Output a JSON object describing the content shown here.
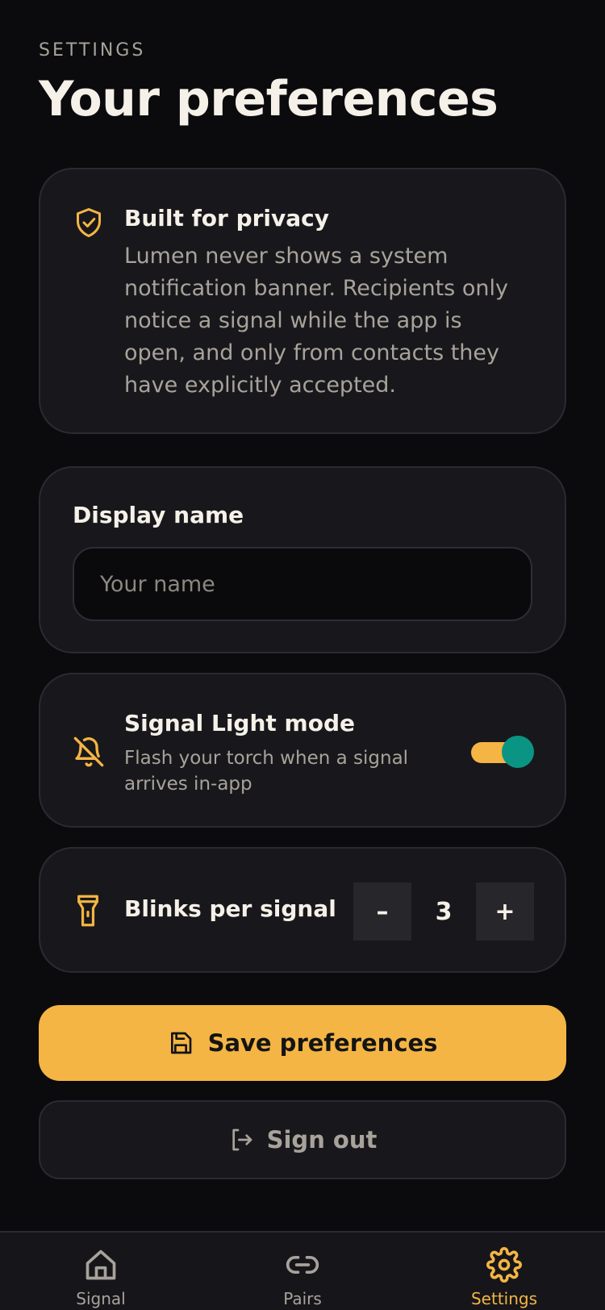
{
  "header": {
    "eyebrow": "SETTINGS",
    "title": "Your preferences"
  },
  "privacy": {
    "icon": "shield-check-icon",
    "heading": "Built for privacy",
    "body": "Lumen never shows a system notification banner. Recipients only notice a signal while the app is open, and only from contacts they have explicitly accepted."
  },
  "display_name": {
    "label": "Display name",
    "value": "",
    "placeholder": "Your name"
  },
  "signal_light": {
    "icon": "bell-off-icon",
    "heading": "Signal Light mode",
    "description": "Flash your torch when a signal arrives in-app",
    "enabled": true
  },
  "blinks": {
    "icon": "flashlight-icon",
    "label": "Blinks per signal",
    "value": "3",
    "decrement_label": "–",
    "increment_label": "+"
  },
  "actions": {
    "save_label": "Save preferences",
    "save_icon": "save-icon",
    "signout_label": "Sign out",
    "signout_icon": "log-out-icon"
  },
  "tabbar": {
    "tabs": [
      {
        "label": "Signal",
        "icon": "home-icon",
        "active": false
      },
      {
        "label": "Pairs",
        "icon": "link-icon",
        "active": false
      },
      {
        "label": "Settings",
        "icon": "gear-icon",
        "active": true
      }
    ]
  },
  "colors": {
    "background": "#0b0b0e",
    "card": "#18181c",
    "accent": "#f4b544",
    "toggle_knob": "#0a9484",
    "muted_text": "#a8a39a"
  }
}
